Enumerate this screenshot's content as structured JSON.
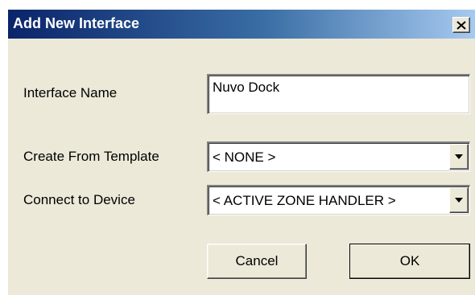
{
  "window": {
    "title": "Add New Interface",
    "close_icon": "close-icon"
  },
  "form": {
    "interface_name": {
      "label": "Interface Name",
      "value": "Nuvo Dock"
    },
    "template": {
      "label": "Create From Template",
      "selected": "< NONE >",
      "dropdown_icon": "triangle-down-icon"
    },
    "device": {
      "label": "Connect to Device",
      "selected": "< ACTIVE ZONE HANDLER >",
      "dropdown_icon": "triangle-down-icon"
    }
  },
  "buttons": {
    "cancel_label": "Cancel",
    "ok_label": "OK"
  },
  "colors": {
    "title_gradient_start": "#0a246a",
    "title_gradient_end": "#a6caf0",
    "dialog_background": "#ece9d8"
  }
}
